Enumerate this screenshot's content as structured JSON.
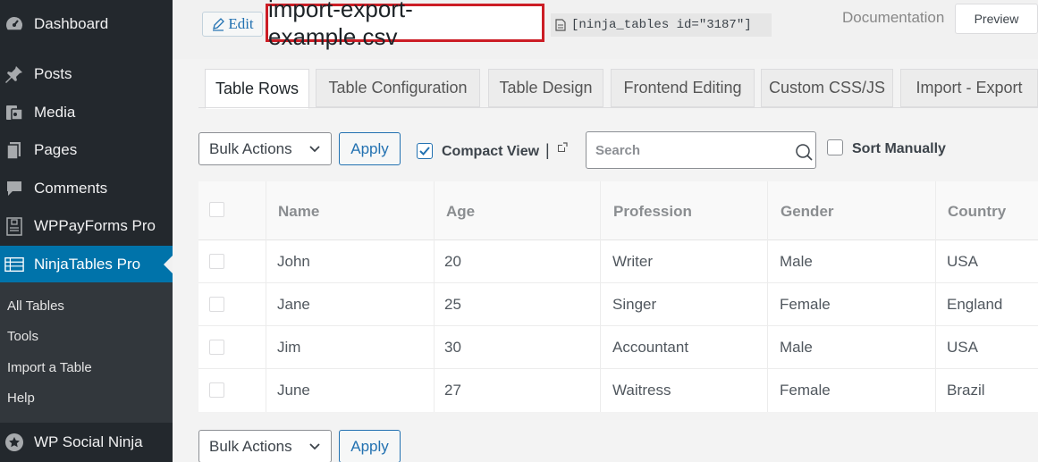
{
  "sidebar": {
    "items": [
      {
        "label": "Dashboard",
        "icon": "dashboard-icon"
      },
      {
        "label": "Posts",
        "icon": "pin-icon"
      },
      {
        "label": "Media",
        "icon": "media-icon"
      },
      {
        "label": "Pages",
        "icon": "pages-icon"
      },
      {
        "label": "Comments",
        "icon": "comment-icon"
      },
      {
        "label": "WPPayForms Pro",
        "icon": "form-icon"
      },
      {
        "label": "NinjaTables Pro",
        "icon": "table-icon"
      },
      {
        "label": "WP Social Ninja",
        "icon": "star-badge-icon"
      }
    ],
    "submenu": [
      "All Tables",
      "Tools",
      "Import a Table",
      "Help"
    ],
    "colors": {
      "bg": "#23282d",
      "active": "#0073aa",
      "submenu_bg": "#32373c"
    }
  },
  "header": {
    "edit_label": "Edit",
    "title": "import-export-example.csv",
    "shortcode": "[ninja_tables id=\"3187\"]",
    "documentation_label": "Documentation",
    "preview_label": "Preview",
    "title_border_color": "#cc1d25"
  },
  "tabs": [
    {
      "label": "Table Rows",
      "active": true
    },
    {
      "label": "Table Configuration",
      "active": false
    },
    {
      "label": "Table Design",
      "active": false
    },
    {
      "label": "Frontend Editing",
      "active": false
    },
    {
      "label": "Custom CSS/JS",
      "active": false
    },
    {
      "label": "Import - Export",
      "active": false
    }
  ],
  "toolbar": {
    "bulk_actions_label": "Bulk Actions",
    "apply_label": "Apply",
    "compact_view_label": "Compact View",
    "compact_view_checked": true,
    "search_placeholder": "Search",
    "sort_manually_label": "Sort Manually",
    "sort_manually_checked": false
  },
  "table": {
    "columns": [
      "Name",
      "Age",
      "Profession",
      "Gender",
      "Country"
    ],
    "rows": [
      [
        "John",
        "20",
        "Writer",
        "Male",
        "USA"
      ],
      [
        "Jane",
        "25",
        "Singer",
        "Female",
        "England"
      ],
      [
        "Jim",
        "30",
        "Accountant",
        "Male",
        "USA"
      ],
      [
        "June",
        "27",
        "Waitress",
        "Female",
        "Brazil"
      ]
    ]
  },
  "footer_toolbar": {
    "bulk_actions_label": "Bulk Actions",
    "apply_label": "Apply"
  }
}
